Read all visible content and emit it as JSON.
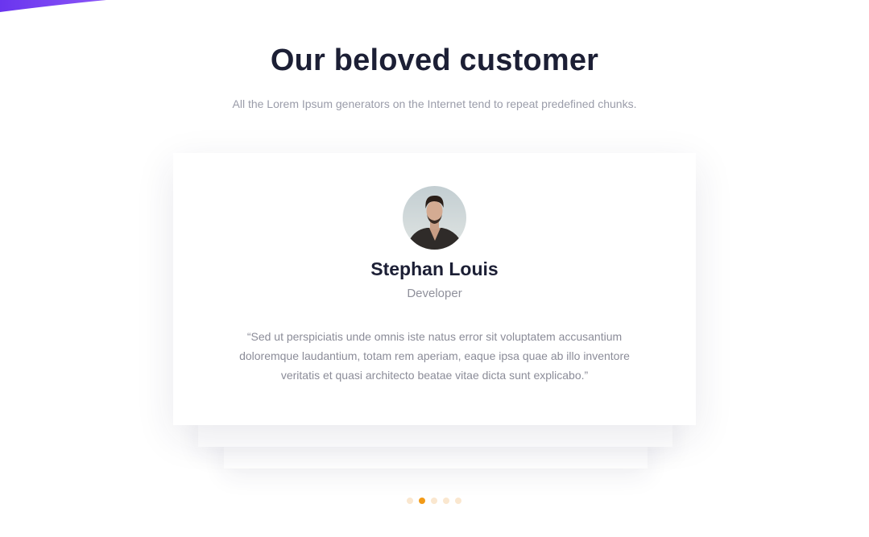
{
  "section": {
    "title": "Our beloved customer",
    "subtitle": "All the Lorem Ipsum generators on the Internet tend to repeat predefined chunks."
  },
  "testimonial": {
    "name": "Stephan Louis",
    "role": "Developer",
    "quote": "“Sed ut perspiciatis unde omnis iste natus error sit voluptatem accusantium doloremque laudantium, totam rem aperiam, eaque ipsa quae ab illo inventore veritatis et quasi architecto beatae vitae dicta sunt explicabo.”"
  },
  "carousel": {
    "dot_count": 5,
    "active_index": 1
  },
  "colors": {
    "accent": "#f29a17",
    "accent_inactive": "#fae7cf",
    "brand_purple": "#7b3ff2",
    "heading": "#1c1f35"
  }
}
